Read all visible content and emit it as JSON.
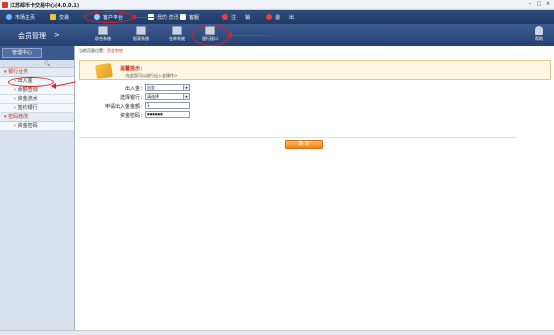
{
  "window": {
    "title": "江苏邮币卡交易中心(4.0.0.1)",
    "minimize": "–",
    "restore": "□",
    "close": "×"
  },
  "menubar": {
    "items": [
      {
        "label": "市场主页",
        "icon": "globe-icon",
        "color": "#6fb3ff"
      },
      {
        "label": "交易",
        "icon": "coin-icon",
        "color": "#f0c040"
      },
      {
        "label": "客户平台",
        "icon": "user-platform-icon",
        "color": "#9fd0ff"
      },
      {
        "label": "我的·资讯",
        "icon": "news-icon",
        "color": "#ffffff"
      },
      {
        "label": "客服",
        "icon": "service-icon",
        "color": "#ffffff"
      },
      {
        "label": "注",
        "icon": "power-icon",
        "color": "#e04040"
      },
      {
        "label": "销",
        "icon": "",
        "color": "#ffffff"
      },
      {
        "label": "退",
        "icon": "power-icon",
        "color": "#e04040"
      },
      {
        "label": "出",
        "icon": "",
        "color": "#ffffff"
      }
    ]
  },
  "navbar": {
    "section": "会员管理",
    "section_arrow": ">",
    "buttons": [
      {
        "label": "综合系统"
      },
      {
        "label": "报表系统"
      },
      {
        "label": "仓库系统"
      },
      {
        "label": "银行接口"
      }
    ],
    "help": "帮助"
  },
  "sidebar": {
    "tab": "管理中心",
    "search_icon": "🔍",
    "groups": [
      {
        "label": "银行业务",
        "items": [
          "出入金",
          "余额查询",
          "资金流水",
          "签约银行"
        ]
      },
      {
        "label": "密码修改",
        "items": [
          "资金密码"
        ]
      }
    ]
  },
  "main": {
    "breadcrumb_prefix": "当前页面位置：",
    "breadcrumb_current": "资金划转",
    "tip_title": "温馨提示：",
    "tip_desc": "在此您可以进行出入金操作>",
    "form": {
      "fields": [
        {
          "label": "出入金：",
          "type": "select",
          "value": "出金"
        },
        {
          "label": "选择银行：",
          "type": "select",
          "value": "请选择"
        },
        {
          "label": "申请出入金金额：",
          "type": "text",
          "value": "1"
        },
        {
          "label": "资金密码：",
          "type": "password",
          "value": "●●●●●●"
        }
      ],
      "submit": "确 定"
    }
  },
  "annotations": {
    "ring_color": "#e02020"
  }
}
